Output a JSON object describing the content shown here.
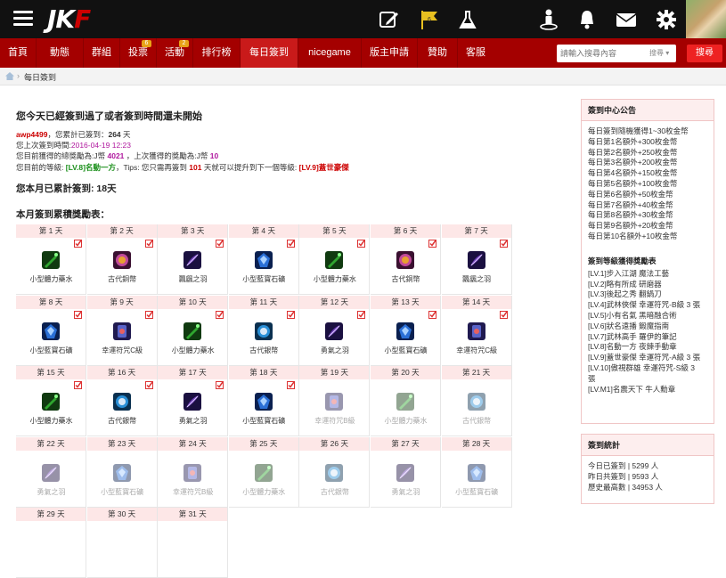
{
  "header": {
    "logo_prefix": "JK",
    "logo_suffix": "F",
    "flag_badge": "6",
    "icons": [
      "hamburger-icon",
      "compose-icon",
      "flag-icon",
      "flask-icon",
      "bell-icon",
      "mail-icon",
      "gear-icon",
      "user-icon"
    ]
  },
  "nav": {
    "items": [
      {
        "label": "首頁"
      },
      {
        "label": "動態"
      },
      {
        "label": "群組"
      },
      {
        "label": "投票",
        "badge": "6"
      },
      {
        "label": "活動",
        "badge": "2"
      },
      {
        "label": "排行榜"
      },
      {
        "label": "每日簽到"
      },
      {
        "label": "nicegame"
      },
      {
        "label": "版主申請"
      },
      {
        "label": "贊助"
      },
      {
        "label": "客服"
      }
    ],
    "active": "每日簽到",
    "search_placeholder": "請輸入搜尋內容",
    "search_scope": "搜尋",
    "search_button": "搜尋"
  },
  "breadcrumb": {
    "current": "每日簽到"
  },
  "main": {
    "heading": "您今天已經簽到過了或者簽到時間還未開始",
    "user": "awp4499",
    "total_text_a": "，您累計已簽到：",
    "total_days": "264",
    "total_text_b": "天",
    "last_label": "您上次簽到時間:",
    "last_time": "2016-04-19 12:23",
    "reward_text_a": "您目前獲得的總獎勵為:J幣",
    "reward_total": "4021",
    "reward_text_b": "，上次獲得的獎勵為:J幣",
    "reward_last": "10",
    "level_text_a": "您目前的等級:",
    "level_current": "[LV.8]名動一方",
    "level_text_b": "，Tips: 您只需再簽到",
    "level_need": "101",
    "level_text_c": "天就可以提升到下一個等級:",
    "level_next": "[LV.9]蓋世豪傑",
    "month_label": "您本月已累計簽到: 18天",
    "table_title": "本月簽到累積獎勵表："
  },
  "rewards": [
    {
      "day": "第 1 天",
      "name": "小型體力藥水",
      "icon": "potion-icon",
      "color": "#2fa52f",
      "signed": true
    },
    {
      "day": "第 2 天",
      "name": "古代銅幣",
      "icon": "coin-icon",
      "color": "#c24a9a",
      "signed": true
    },
    {
      "day": "第 3 天",
      "name": "飄颻之羽",
      "icon": "feather-icon",
      "color": "#6b3bb5",
      "signed": true
    },
    {
      "day": "第 4 天",
      "name": "小型藍寶石礦",
      "icon": "ore-icon",
      "color": "#2a6fd6",
      "signed": true
    },
    {
      "day": "第 5 天",
      "name": "小型體力藥水",
      "icon": "potion-icon",
      "color": "#2fa52f",
      "signed": true
    },
    {
      "day": "第 6 天",
      "name": "古代銅幣",
      "icon": "coin-icon",
      "color": "#c24a9a",
      "signed": true
    },
    {
      "day": "第 7 天",
      "name": "飄颻之羽",
      "icon": "feather-icon",
      "color": "#6b3bb5",
      "signed": true
    },
    {
      "day": "第 8 天",
      "name": "小型藍寶石礦",
      "icon": "ore-icon",
      "color": "#2a6fd6",
      "signed": true
    },
    {
      "day": "第 9 天",
      "name": "幸運符咒C級",
      "icon": "charm-icon",
      "color": "#5a64c9",
      "signed": true
    },
    {
      "day": "第 10 天",
      "name": "小型體力藥水",
      "icon": "potion-icon",
      "color": "#2fa52f",
      "signed": true
    },
    {
      "day": "第 11 天",
      "name": "古代銀幣",
      "icon": "silver-coin-icon",
      "color": "#2a8fd6",
      "signed": true
    },
    {
      "day": "第 12 天",
      "name": "勇氣之羽",
      "icon": "feather-icon",
      "color": "#6b3bb5",
      "signed": true
    },
    {
      "day": "第 13 天",
      "name": "小型藍寶石礦",
      "icon": "ore-icon",
      "color": "#2a6fd6",
      "signed": true
    },
    {
      "day": "第 14 天",
      "name": "幸運符咒C級",
      "icon": "charm-icon",
      "color": "#5a64c9",
      "signed": true
    },
    {
      "day": "第 15 天",
      "name": "小型體力藥水",
      "icon": "potion-icon",
      "color": "#2fa52f",
      "signed": true
    },
    {
      "day": "第 16 天",
      "name": "古代銀幣",
      "icon": "silver-coin-icon",
      "color": "#2a8fd6",
      "signed": true
    },
    {
      "day": "第 17 天",
      "name": "勇氣之羽",
      "icon": "feather-icon",
      "color": "#6b3bb5",
      "signed": true
    },
    {
      "day": "第 18 天",
      "name": "小型藍寶石礦",
      "icon": "ore-icon",
      "color": "#2a6fd6",
      "signed": true
    },
    {
      "day": "第 19 天",
      "name": "幸運符咒B級",
      "icon": "charm-icon",
      "color": "#5a64c9",
      "signed": false
    },
    {
      "day": "第 20 天",
      "name": "小型體力藥水",
      "icon": "potion-icon",
      "color": "#2fa52f",
      "signed": false
    },
    {
      "day": "第 21 天",
      "name": "古代銀幣",
      "icon": "silver-coin-icon",
      "color": "#2a8fd6",
      "signed": false
    },
    {
      "day": "第 22 天",
      "name": "勇氣之羽",
      "icon": "feather-icon",
      "color": "#6b3bb5",
      "signed": false
    },
    {
      "day": "第 23 天",
      "name": "小型藍寶石礦",
      "icon": "ore-icon",
      "color": "#2a6fd6",
      "signed": false
    },
    {
      "day": "第 24 天",
      "name": "幸運符咒B級",
      "icon": "charm-icon",
      "color": "#5a64c9",
      "signed": false
    },
    {
      "day": "第 25 天",
      "name": "小型體力藥水",
      "icon": "potion-icon",
      "color": "#2fa52f",
      "signed": false
    },
    {
      "day": "第 26 天",
      "name": "古代銀幣",
      "icon": "silver-coin-icon",
      "color": "#2a8fd6",
      "signed": false
    },
    {
      "day": "第 27 天",
      "name": "勇氣之羽",
      "icon": "feather-icon",
      "color": "#6b3bb5",
      "signed": false
    },
    {
      "day": "第 28 天",
      "name": "小型藍寶石礦",
      "icon": "ore-icon",
      "color": "#2a6fd6",
      "signed": false
    },
    {
      "day": "第 29 天",
      "name": "",
      "icon": "",
      "color": "",
      "signed": false
    },
    {
      "day": "第 30 天",
      "name": "",
      "icon": "",
      "color": "",
      "signed": false
    },
    {
      "day": "第 31 天",
      "name": "",
      "icon": "",
      "color": "",
      "signed": false
    }
  ],
  "sidebar": {
    "notice_title": "簽到中心公告",
    "notice_lines": [
      "每日簽到隨機獲得1~30枚金幣",
      "每日第1名額外+300枚金幣",
      "每日第2名額外+250枚金幣",
      "每日第3名額外+200枚金幣",
      "每日第4名額外+150枚金幣",
      "每日第5名額外+100枚金幣",
      "每日第6名額外+50枚金幣",
      "每日第7名額外+40枚金幣",
      "每日第8名額外+30枚金幣",
      "每日第9名額外+20枚金幣",
      "每日第10名額外+10枚金幣"
    ],
    "level_title": "簽到等級獲得獎勵表",
    "level_lines": [
      "[LV.1]步入江湖 魔法工藝",
      "[LV.2]略有所成 研磨器",
      "[LV.3]後起之秀 翻鍋刀",
      "[LV.4]武林俠傑 幸運符咒-B級 3 張",
      "[LV.5]小有名氣 黑暗融合術",
      "[LV.6]狀名遠播 鍛魔指南",
      "[LV.7]武林高手 羅伊的筆記",
      "[LV.8]名動一方 夜鍊手動章",
      "[LV.9]蓋世豪傑 幸運符咒-A級 3 張",
      "[LV.10]傲視群雄 幸運符咒-S級 3",
      "張",
      "[LV.M1]名震天下 牛人勳章"
    ],
    "stats_title": "簽到統計",
    "stats_lines": [
      "今日已簽到 | 5299 人",
      "昨日共簽到 | 9593 人",
      "歷史最高數 | 34953 人"
    ]
  }
}
